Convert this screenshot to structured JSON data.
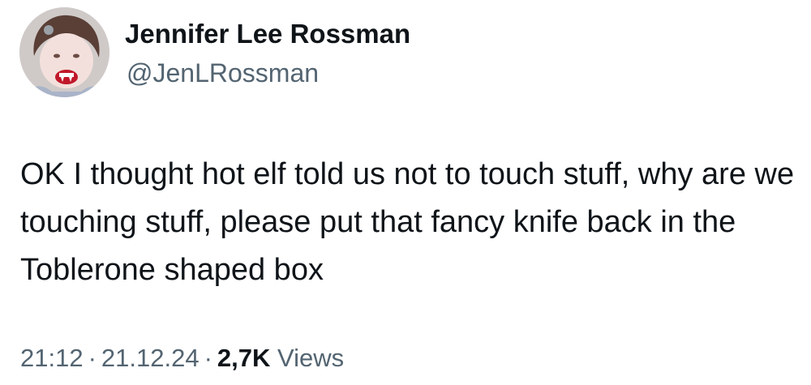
{
  "author": {
    "display_name": "Jennifer Lee Rossman",
    "handle": "@JenLRossman",
    "avatar": "profile-photo-avatar"
  },
  "tweet": {
    "text": "OK I thought hot elf told us not to touch stuff, why are we touching stuff, please put that fancy knife back in the Toblerone shaped box"
  },
  "meta": {
    "time": "21:12",
    "separator": "·",
    "date": "21.12.24",
    "views_count": "2,7K",
    "views_label": "Views"
  },
  "colors": {
    "text_primary": "#0f1419",
    "text_secondary": "#536471",
    "background": "#ffffff"
  }
}
